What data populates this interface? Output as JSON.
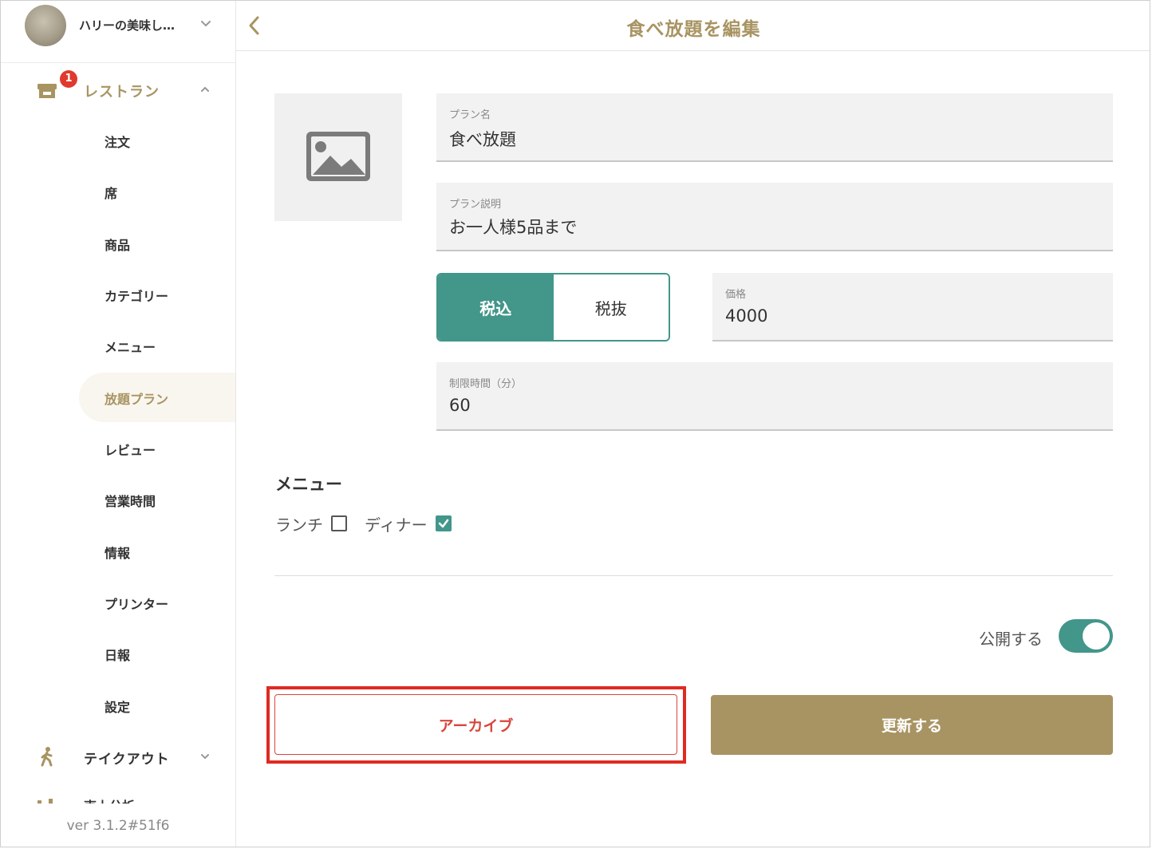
{
  "sidebar": {
    "shop_name": "ハリーの美味し…",
    "restaurant_section": {
      "label": "レストラン",
      "badge": "1"
    },
    "items": [
      {
        "label": "注文"
      },
      {
        "label": "席"
      },
      {
        "label": "商品"
      },
      {
        "label": "カテゴリー"
      },
      {
        "label": "メニュー"
      },
      {
        "label": "放題プラン",
        "active": true
      },
      {
        "label": "レビュー"
      },
      {
        "label": "営業時間"
      },
      {
        "label": "情報"
      },
      {
        "label": "プリンター"
      },
      {
        "label": "日報"
      },
      {
        "label": "設定"
      }
    ],
    "takeout_section": {
      "label": "テイクアウト"
    },
    "next_section_partial": "売上分析",
    "version": "ver 3.1.2#51f6"
  },
  "header": {
    "title": "食べ放題を編集"
  },
  "form": {
    "plan_name": {
      "label": "プラン名",
      "value": "食べ放題"
    },
    "plan_description": {
      "label": "プラン説明",
      "value": "お一人様5品まで"
    },
    "tax_toggle": {
      "included": "税込",
      "excluded": "税抜",
      "selected": "税込"
    },
    "price": {
      "label": "価格",
      "value": "4000"
    },
    "time_limit": {
      "label": "制限時間（分）",
      "value": "60"
    },
    "menu": {
      "heading": "メニュー",
      "options": [
        {
          "label": "ランチ",
          "checked": false
        },
        {
          "label": "ディナー",
          "checked": true
        }
      ]
    },
    "publish": {
      "label": "公開する",
      "on": true
    },
    "archive_button": "アーカイブ",
    "update_button": "更新する"
  },
  "colors": {
    "accent_gold": "#a89462",
    "teal": "#42968a",
    "danger": "#d9463c",
    "highlight_red": "#e02a21",
    "badge_red": "#e03a2f"
  },
  "icons": {
    "back": "chevron-left-icon",
    "shop_dropdown": "chevron-down-icon",
    "restaurant": "store-icon",
    "takeout": "walking-person-icon",
    "image_placeholder": "image-icon"
  }
}
